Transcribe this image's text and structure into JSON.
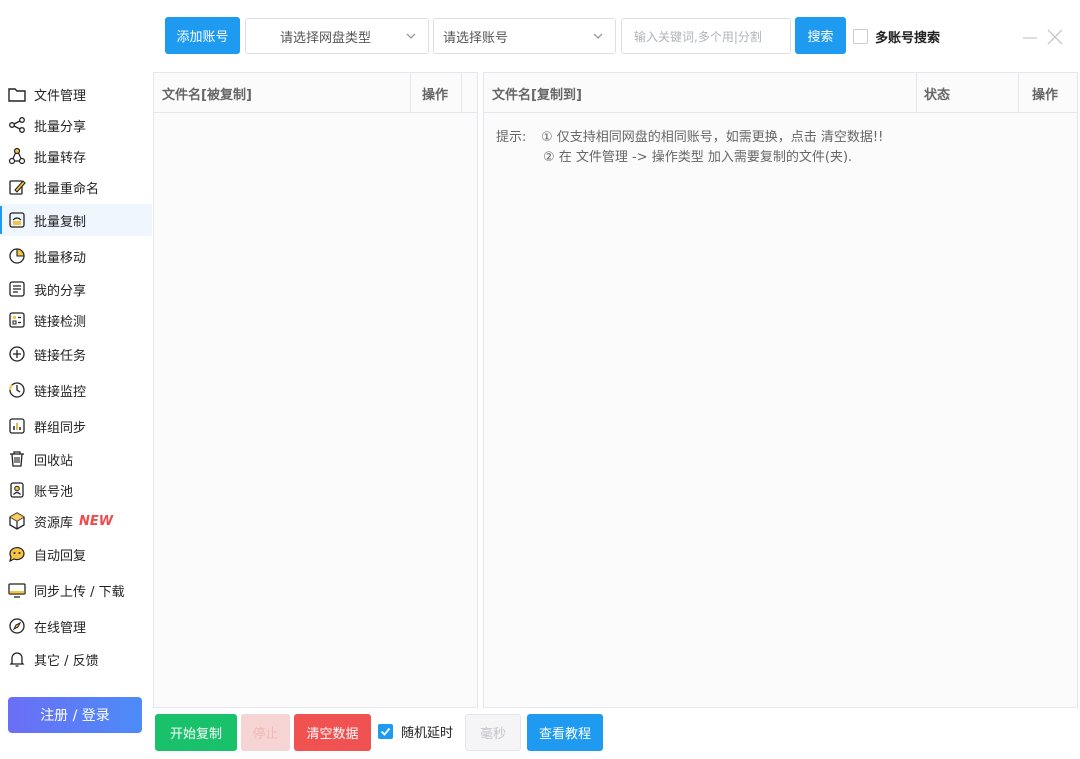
{
  "toolbar": {
    "add_account": "添加账号",
    "disk_type_placeholder": "请选择网盘类型",
    "account_placeholder": "请选择账号",
    "keyword_placeholder": "输入关键词,多个用|分割",
    "search": "搜索",
    "multi_account_search": "多账号搜索"
  },
  "sidebar": {
    "items": [
      {
        "label": "文件管理",
        "icon": "folder-icon"
      },
      {
        "label": "批量分享",
        "icon": "share-icon"
      },
      {
        "label": "批量转存",
        "icon": "transfer-icon"
      },
      {
        "label": "批量重命名",
        "icon": "rename-icon"
      },
      {
        "label": "批量复制",
        "icon": "copy-icon"
      },
      {
        "label": "批量移动",
        "icon": "move-icon"
      },
      {
        "label": "我的分享",
        "icon": "my-share-icon"
      },
      {
        "label": "链接检测",
        "icon": "link-check-icon"
      },
      {
        "label": "链接任务",
        "icon": "link-task-icon"
      },
      {
        "label": "链接监控",
        "icon": "link-monitor-icon"
      },
      {
        "label": "群组同步",
        "icon": "group-sync-icon"
      },
      {
        "label": "回收站",
        "icon": "trash-icon"
      },
      {
        "label": "账号池",
        "icon": "account-pool-icon"
      },
      {
        "label": "资源库",
        "icon": "resource-icon",
        "badge": "NEW"
      },
      {
        "label": "自动回复",
        "icon": "auto-reply-icon"
      },
      {
        "label": "同步上传 / 下载",
        "icon": "sync-upload-icon"
      },
      {
        "label": "在线管理",
        "icon": "online-manage-icon"
      },
      {
        "label": "其它 / 反馈",
        "icon": "bell-icon"
      }
    ],
    "active": "批量复制",
    "login": "注册 / 登录"
  },
  "left_panel": {
    "col_filename": "文件名[被复制]",
    "col_action": "操作"
  },
  "right_panel": {
    "col_filename": "文件名[复制到]",
    "col_status": "状态",
    "col_action": "操作",
    "tip_label": "提示:",
    "tip_1": "① 仅支持相同网盘的相同账号，如需更换，点击 清空数据!!",
    "tip_2": "② 在 文件管理 -> 操作类型 加入需要复制的文件(夹)."
  },
  "bottom": {
    "start_copy": "开始复制",
    "stop": "停止",
    "clear": "清空数据",
    "random_delay": "随机延时",
    "ms": "毫秒",
    "tutorial": "查看教程",
    "random_delay_checked": true
  },
  "colors": {
    "primary": "#1e9bf0",
    "green": "#19c16b",
    "red": "#f05252",
    "new_badge": "#f04b4b"
  }
}
